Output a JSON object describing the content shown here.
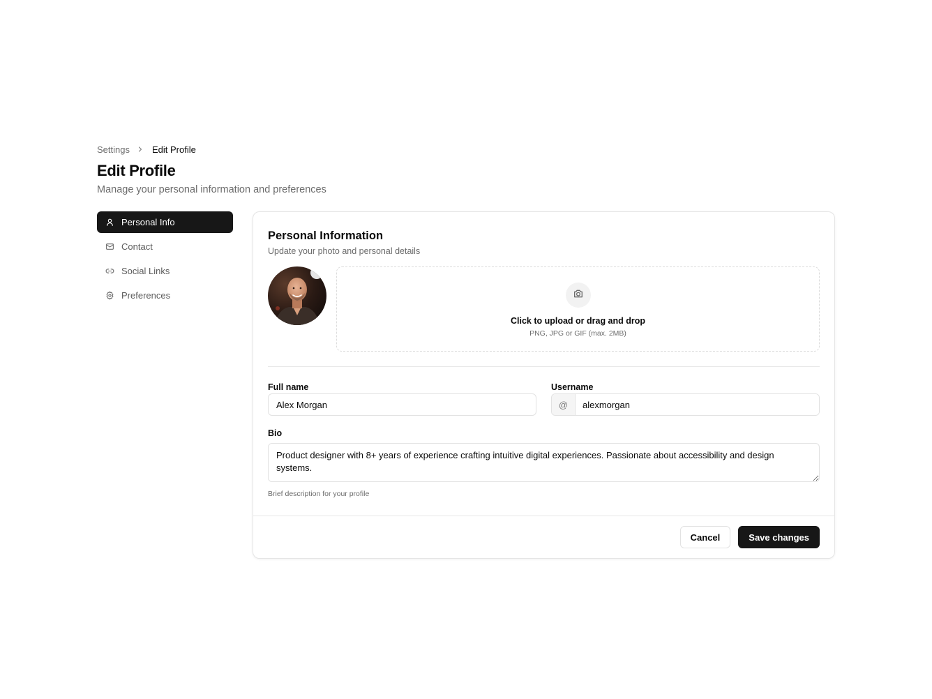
{
  "breadcrumb": {
    "parent": "Settings",
    "current": "Edit Profile"
  },
  "header": {
    "title": "Edit Profile",
    "subtitle": "Manage your personal information and preferences"
  },
  "sidebar": {
    "items": [
      {
        "label": "Personal Info",
        "icon": "user-icon",
        "active": true
      },
      {
        "label": "Contact",
        "icon": "mail-icon",
        "active": false
      },
      {
        "label": "Social Links",
        "icon": "link-icon",
        "active": false
      },
      {
        "label": "Preferences",
        "icon": "gear-icon",
        "active": false
      }
    ]
  },
  "card": {
    "title": "Personal Information",
    "subtitle": "Update your photo and personal details",
    "upload": {
      "icon": "camera-icon",
      "title": "Click to upload or drag and drop",
      "hint": "PNG, JPG or GIF (max. 2MB)"
    },
    "full_name": {
      "label": "Full name",
      "value": "Alex Morgan"
    },
    "username": {
      "label": "Username",
      "prefix": "@",
      "value": "alexmorgan"
    },
    "bio": {
      "label": "Bio",
      "value": "Product designer with 8+ years of experience crafting intuitive digital experiences. Passionate about accessibility and design systems.",
      "help": "Brief description for your profile"
    },
    "footer": {
      "cancel_label": "Cancel",
      "save_label": "Save changes"
    }
  },
  "colors": {
    "primary": "#171717",
    "border": "#e2e2e2",
    "muted_text": "#6b6b6b"
  }
}
